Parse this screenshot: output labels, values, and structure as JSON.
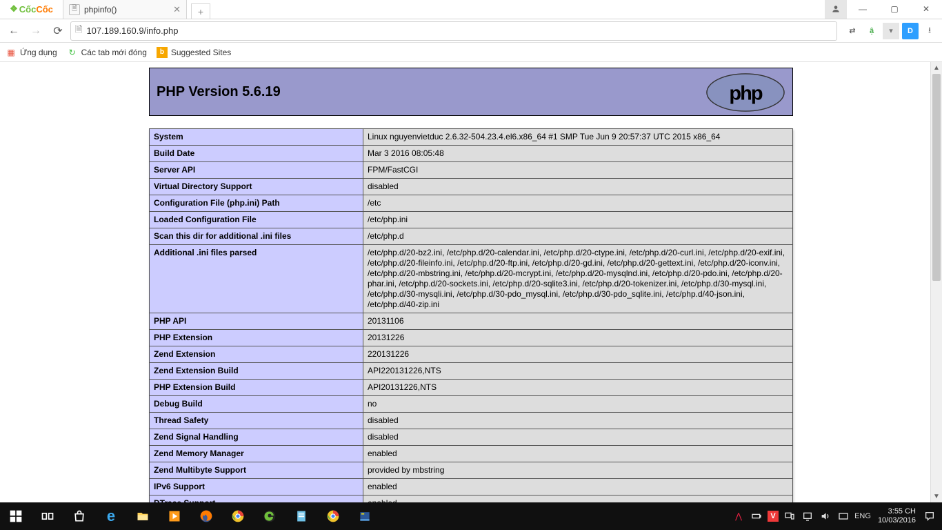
{
  "browser": {
    "logo": {
      "t1": "Cốc",
      "t2": "Cốc"
    },
    "tab": {
      "title": "phpinfo()"
    },
    "url": "107.189.160.9/info.php",
    "bookmarks": [
      {
        "label": "Ứng dụng",
        "icon": "apps",
        "color": "#e8513c"
      },
      {
        "label": "Các tab mới đóng",
        "icon": "restore",
        "color": "#3bbf3b"
      },
      {
        "label": "Suggested Sites",
        "icon": "bing",
        "color": "#f7a700"
      }
    ]
  },
  "phpinfo": {
    "title": "PHP Version 5.6.19",
    "rows": [
      {
        "k": "System",
        "v": "Linux nguyenvietduc 2.6.32-504.23.4.el6.x86_64 #1 SMP Tue Jun 9 20:57:37 UTC 2015 x86_64"
      },
      {
        "k": "Build Date",
        "v": "Mar 3 2016 08:05:48"
      },
      {
        "k": "Server API",
        "v": "FPM/FastCGI"
      },
      {
        "k": "Virtual Directory Support",
        "v": "disabled"
      },
      {
        "k": "Configuration File (php.ini) Path",
        "v": "/etc"
      },
      {
        "k": "Loaded Configuration File",
        "v": "/etc/php.ini"
      },
      {
        "k": "Scan this dir for additional .ini files",
        "v": "/etc/php.d"
      },
      {
        "k": "Additional .ini files parsed",
        "v": "/etc/php.d/20-bz2.ini, /etc/php.d/20-calendar.ini, /etc/php.d/20-ctype.ini, /etc/php.d/20-curl.ini, /etc/php.d/20-exif.ini, /etc/php.d/20-fileinfo.ini, /etc/php.d/20-ftp.ini, /etc/php.d/20-gd.ini, /etc/php.d/20-gettext.ini, /etc/php.d/20-iconv.ini, /etc/php.d/20-mbstring.ini, /etc/php.d/20-mcrypt.ini, /etc/php.d/20-mysqlnd.ini, /etc/php.d/20-pdo.ini, /etc/php.d/20-phar.ini, /etc/php.d/20-sockets.ini, /etc/php.d/20-sqlite3.ini, /etc/php.d/20-tokenizer.ini, /etc/php.d/30-mysql.ini, /etc/php.d/30-mysqli.ini, /etc/php.d/30-pdo_mysql.ini, /etc/php.d/30-pdo_sqlite.ini, /etc/php.d/40-json.ini, /etc/php.d/40-zip.ini"
      },
      {
        "k": "PHP API",
        "v": "20131106"
      },
      {
        "k": "PHP Extension",
        "v": "20131226"
      },
      {
        "k": "Zend Extension",
        "v": "220131226"
      },
      {
        "k": "Zend Extension Build",
        "v": "API220131226,NTS"
      },
      {
        "k": "PHP Extension Build",
        "v": "API20131226,NTS"
      },
      {
        "k": "Debug Build",
        "v": "no"
      },
      {
        "k": "Thread Safety",
        "v": "disabled"
      },
      {
        "k": "Zend Signal Handling",
        "v": "disabled"
      },
      {
        "k": "Zend Memory Manager",
        "v": "enabled"
      },
      {
        "k": "Zend Multibyte Support",
        "v": "provided by mbstring"
      },
      {
        "k": "IPv6 Support",
        "v": "enabled"
      },
      {
        "k": "DTrace Support",
        "v": "enabled"
      }
    ]
  },
  "taskbar": {
    "lang": "ENG",
    "time": "3:55 CH",
    "date": "10/03/2016"
  }
}
